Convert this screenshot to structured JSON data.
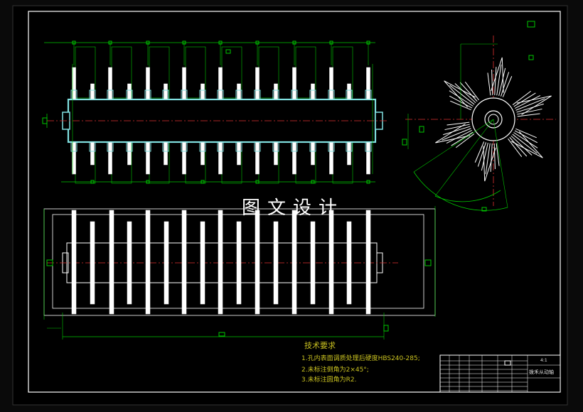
{
  "drawing": {
    "watermark": "图文设计",
    "technical_requirements": {
      "title": "技术要求",
      "items": [
        "1.孔内表面调质处理后硬度HBS240-285;",
        "2.未标注倒角为2×45°;",
        "3.未标注圆角为R2."
      ]
    },
    "title_block": {
      "part_name": "拨禾从动轴",
      "scale": "4:1"
    },
    "colors": {
      "background": "#000000",
      "border": "#ffffff",
      "dimension": "#00c800",
      "outline": "#ffffff",
      "section": "#80e0e0",
      "centerline": "#e03030",
      "text": "#c8c020"
    }
  }
}
